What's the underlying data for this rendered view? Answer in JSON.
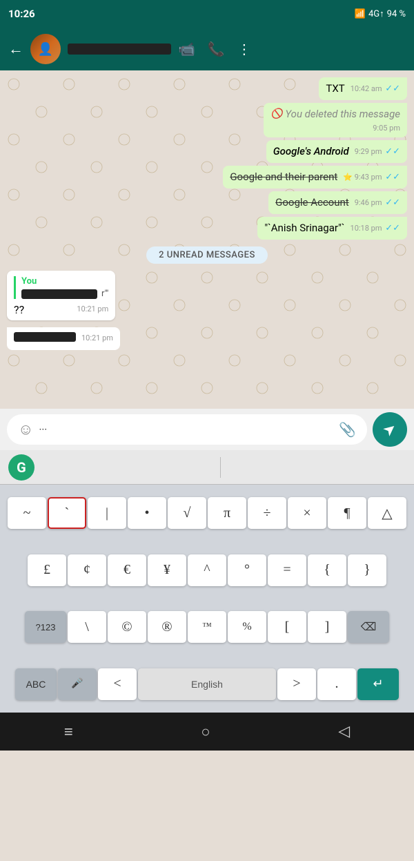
{
  "status_bar": {
    "time": "10:26",
    "signal": "4G↑",
    "battery": "94 %"
  },
  "top_bar": {
    "contact_name": "REDACTED",
    "video_icon": "📹",
    "call_icon": "📞",
    "more_icon": "⋮",
    "back_icon": "←"
  },
  "chat": {
    "messages": [
      {
        "type": "sent",
        "text": "TXT",
        "time": "10:42 am",
        "ticks": "✓✓",
        "ticks_color": "blue"
      },
      {
        "type": "sent",
        "text": "You deleted this message",
        "time": "9:05 pm",
        "deleted": true
      },
      {
        "type": "sent",
        "text": "Google's Android",
        "italic": true,
        "time": "9:29 pm",
        "ticks": "✓✓",
        "ticks_color": "blue"
      },
      {
        "type": "sent",
        "text": "Google and their parent",
        "strikethrough": true,
        "time": "9:43 pm",
        "ticks": "✓✓",
        "ticks_color": "blue",
        "star": true
      },
      {
        "type": "sent",
        "text": "Google Account",
        "strikethrough": true,
        "time": "9:46 pm",
        "ticks": "✓✓",
        "ticks_color": "blue"
      },
      {
        "type": "sent",
        "text": "\"`Anish Srinagar\"`",
        "time": "10:18 pm",
        "ticks": "✓✓",
        "ticks_color": "blue"
      }
    ],
    "unread_label": "2 UNREAD MESSAGES",
    "reply_message": {
      "sender": "You",
      "quoted_text": "REDACTED",
      "body": "??",
      "time": "10:21 pm"
    },
    "received_message": {
      "text": "REDACTED",
      "time": "10:21 pm"
    }
  },
  "input_bar": {
    "emoji_placeholder": "☺",
    "dots": "···",
    "send_icon": "➤"
  },
  "keyboard": {
    "grammarly_letter": "G",
    "row1": [
      "~",
      "`",
      "|",
      "•",
      "√",
      "π",
      "÷",
      "×",
      "¶",
      "△"
    ],
    "row2": [
      "£",
      "¢",
      "€",
      "¥",
      "^",
      "°",
      "=",
      "{",
      "}"
    ],
    "row3_left": "?123",
    "row3": [
      "\\",
      "©",
      "®",
      "™",
      "%",
      "[",
      "]"
    ],
    "row3_backspace": "⌫",
    "row4_abc": "ABC",
    "row4_mic": "🎤",
    "row4_lt": "<",
    "row4_space": "English",
    "row4_gt": ">",
    "row4_dot": ".",
    "row4_enter": "↵",
    "highlighted_key": "`"
  },
  "bottom_nav": {
    "home": "≡",
    "circle": "○",
    "back": "◁"
  }
}
